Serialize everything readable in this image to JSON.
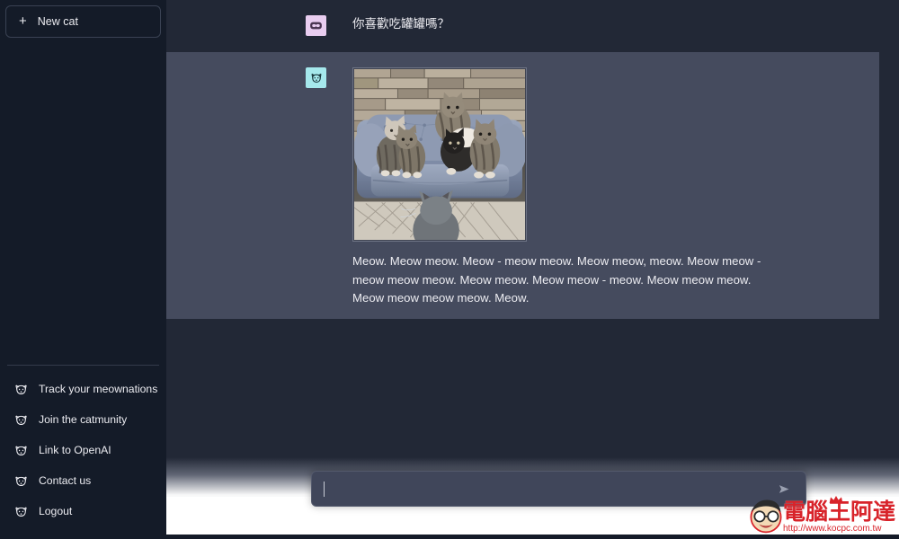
{
  "app": {
    "theme": "dark",
    "accent_user_avatar": "#e9cdf0",
    "accent_assistant_avatar": "#a5e8ec",
    "sidebar_bg": "#141b28",
    "main_bg": "#222836",
    "assistant_row_bg": "#454b5e"
  },
  "sidebar": {
    "new_chat": {
      "label": "New cat",
      "icon": "plus-icon"
    },
    "footer_items": [
      {
        "label": "Track your meownations",
        "icon": "cat-face-icon"
      },
      {
        "label": "Join the catmunity",
        "icon": "cat-face-icon"
      },
      {
        "label": "Link to OpenAI",
        "icon": "cat-face-icon"
      },
      {
        "label": "Contact us",
        "icon": "cat-face-icon"
      },
      {
        "label": "Logout",
        "icon": "cat-face-icon"
      }
    ]
  },
  "conversation": {
    "messages": [
      {
        "role": "user",
        "avatar_icon": "user-avatar-icon",
        "text": "你喜歡吃罐罐嗎？"
      },
      {
        "role": "assistant",
        "avatar_icon": "cat-avatar-icon",
        "image_alt": "five kittens on a blue tufted velvet sofa in front of a stacked stone wall",
        "text": "Meow. Meow meow. Meow - meow meow. Meow meow, meow. Meow meow - meow meow meow. Meow meow. Meow meow - meow. Meow meow meow. Meow meow meow meow. Meow."
      }
    ]
  },
  "composer": {
    "value": "",
    "placeholder": "",
    "send_icon": "send-arrow-icon"
  },
  "watermark": {
    "title": "電腦王阿達",
    "url": "http://www.kocpc.com.tw",
    "icon": "mascot-face-icon"
  }
}
